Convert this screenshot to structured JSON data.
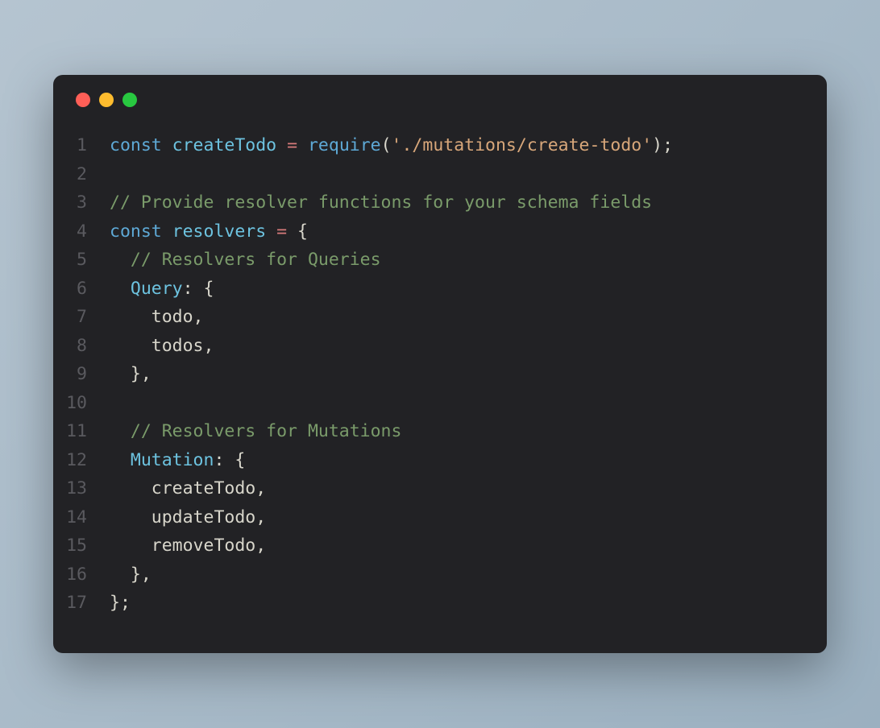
{
  "window": {
    "traffic_lights": [
      "close",
      "minimize",
      "maximize"
    ]
  },
  "code": {
    "lines": [
      {
        "num": "1",
        "tokens": [
          {
            "t": "const ",
            "c": "tok-keyword"
          },
          {
            "t": "createTodo",
            "c": "tok-declname"
          },
          {
            "t": " ",
            "c": "tok-punct"
          },
          {
            "t": "=",
            "c": "tok-operator"
          },
          {
            "t": " ",
            "c": "tok-punct"
          },
          {
            "t": "require",
            "c": "tok-func"
          },
          {
            "t": "(",
            "c": "tok-punct"
          },
          {
            "t": "'./mutations/create-todo'",
            "c": "tok-string"
          },
          {
            "t": ");",
            "c": "tok-punct"
          }
        ]
      },
      {
        "num": "2",
        "tokens": []
      },
      {
        "num": "3",
        "tokens": [
          {
            "t": "// Provide resolver functions for your schema fields",
            "c": "tok-comment"
          }
        ]
      },
      {
        "num": "4",
        "tokens": [
          {
            "t": "const ",
            "c": "tok-keyword"
          },
          {
            "t": "resolvers",
            "c": "tok-declname"
          },
          {
            "t": " ",
            "c": "tok-punct"
          },
          {
            "t": "=",
            "c": "tok-operator"
          },
          {
            "t": " {",
            "c": "tok-punct"
          }
        ]
      },
      {
        "num": "5",
        "tokens": [
          {
            "t": "  ",
            "c": "tok-punct"
          },
          {
            "t": "// Resolvers for Queries",
            "c": "tok-comment"
          }
        ]
      },
      {
        "num": "6",
        "tokens": [
          {
            "t": "  ",
            "c": "tok-punct"
          },
          {
            "t": "Query",
            "c": "tok-prop"
          },
          {
            "t": ": {",
            "c": "tok-punct"
          }
        ]
      },
      {
        "num": "7",
        "tokens": [
          {
            "t": "    todo,",
            "c": "tok-identifier"
          }
        ]
      },
      {
        "num": "8",
        "tokens": [
          {
            "t": "    todos,",
            "c": "tok-identifier"
          }
        ]
      },
      {
        "num": "9",
        "tokens": [
          {
            "t": "  },",
            "c": "tok-punct"
          }
        ]
      },
      {
        "num": "10",
        "tokens": []
      },
      {
        "num": "11",
        "tokens": [
          {
            "t": "  ",
            "c": "tok-punct"
          },
          {
            "t": "// Resolvers for Mutations",
            "c": "tok-comment"
          }
        ]
      },
      {
        "num": "12",
        "tokens": [
          {
            "t": "  ",
            "c": "tok-punct"
          },
          {
            "t": "Mutation",
            "c": "tok-prop"
          },
          {
            "t": ": {",
            "c": "tok-punct"
          }
        ]
      },
      {
        "num": "13",
        "tokens": [
          {
            "t": "    createTodo,",
            "c": "tok-identifier"
          }
        ]
      },
      {
        "num": "14",
        "tokens": [
          {
            "t": "    updateTodo,",
            "c": "tok-identifier"
          }
        ]
      },
      {
        "num": "15",
        "tokens": [
          {
            "t": "    removeTodo,",
            "c": "tok-identifier"
          }
        ]
      },
      {
        "num": "16",
        "tokens": [
          {
            "t": "  },",
            "c": "tok-punct"
          }
        ]
      },
      {
        "num": "17",
        "tokens": [
          {
            "t": "};",
            "c": "tok-punct"
          }
        ]
      }
    ]
  }
}
